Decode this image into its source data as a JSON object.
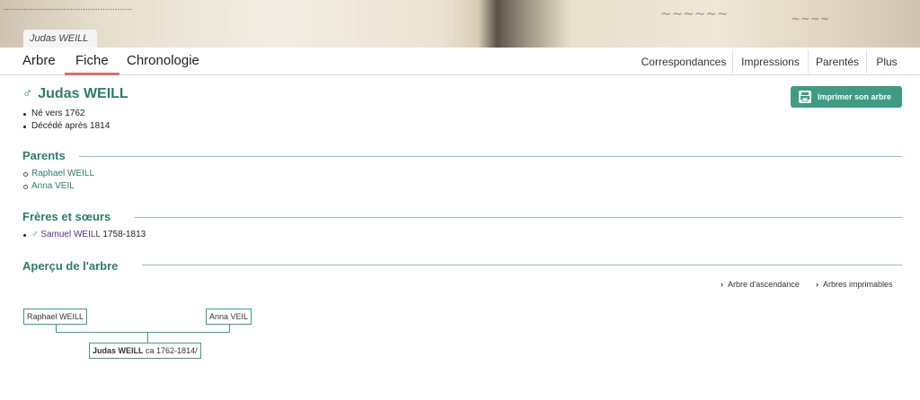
{
  "header": {
    "name_tab": "Judas WEILL"
  },
  "nav": {
    "tabs": [
      {
        "label": "Arbre",
        "active": false
      },
      {
        "label": "Fiche",
        "active": true
      },
      {
        "label": "Chronologie",
        "active": false
      }
    ],
    "right_items": [
      "Correspondances",
      "Impressions",
      "Parentés",
      "Plus"
    ]
  },
  "person": {
    "sex_symbol": "♂",
    "name": "Judas WEILL",
    "facts": [
      "Né vers 1762",
      "Décédé après 1814"
    ]
  },
  "print_button": {
    "label": "Imprimer son arbre",
    "icon": "printer-icon"
  },
  "sections": {
    "parents": {
      "title": "Parents",
      "items": [
        "Raphael WEILL",
        "Anna VEIL"
      ]
    },
    "siblings": {
      "title": "Frères et sœurs",
      "items": [
        {
          "sex_symbol": "♂",
          "name": "Samuel WEILL",
          "dates": "1758-1813"
        }
      ]
    },
    "tree_preview": {
      "title": "Aperçu de l'arbre",
      "links": [
        "Arbre d'ascendance",
        "Arbres imprimables"
      ],
      "father": "Raphael WEILL",
      "mother": "Anna VEIL",
      "subject_name": "Judas WEILL",
      "subject_dates": "ca 1762-1814/"
    }
  },
  "colors": {
    "accent": "#2b7d6c",
    "button": "#3d9c83",
    "active_tab_underline": "#e06a6a",
    "sibling_link": "#5b2d8c"
  }
}
